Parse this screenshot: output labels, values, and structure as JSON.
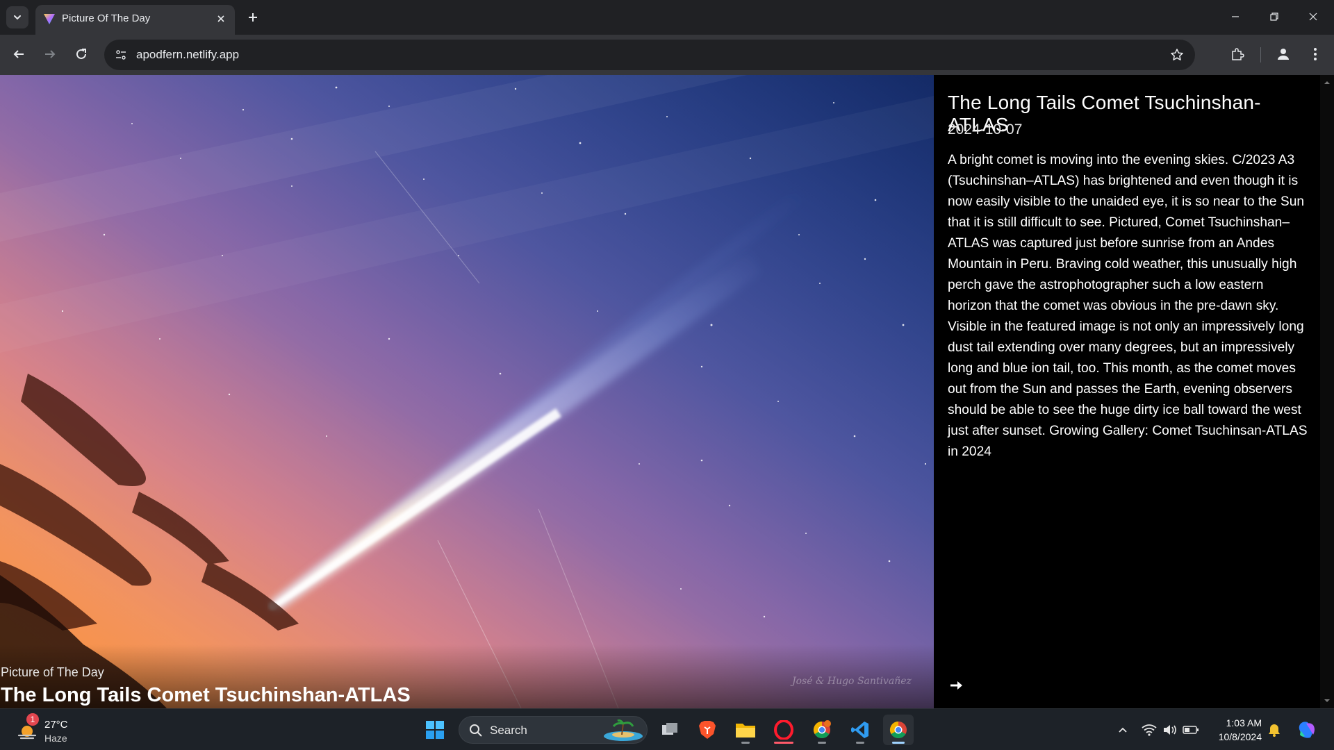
{
  "browser": {
    "tab_title": "Picture Of The Day",
    "url": "apodfern.netlify.app"
  },
  "page": {
    "kicker": "Picture of The Day",
    "headline": "The Long Tails Comet Tsuchinshan-ATLAS",
    "signature": "José & Hugo Santivañez",
    "info_title": "The Long Tails Comet Tsuchinshan-ATLAS",
    "date": "2024-10-07",
    "explanation": "A bright comet is moving into the evening skies. C/2023 A3 (Tsuchinshan–ATLAS) has brightened and even though it is now easily visible to the unaided eye, it is so near to the Sun that it is still difficult to see. Pictured, Comet Tsuchinshan–ATLAS was captured just before sunrise from an Andes Mountain in Peru. Braving cold weather, this unusually high perch gave the astrophotographer such a low eastern horizon that the comet was obvious in the pre-dawn sky. Visible in the featured image is not only an impressively long dust tail extending over many degrees, but an impressively long and blue ion tail, too.  This month, as the comet moves out from the Sun and passes the Earth, evening observers should be able to see the huge dirty ice ball toward the west just after sunset. Growing Gallery: Comet Tsuchinsan-ATLAS in 2024"
  },
  "taskbar": {
    "weather_badge": "1",
    "temperature": "27°C",
    "condition": "Haze",
    "search_label": "Search",
    "time": "1:03 AM",
    "date": "10/8/2024"
  },
  "colors": {
    "chrome_dark": "#202124",
    "chrome_toolbar": "#35363a",
    "taskbar": "#1d2228",
    "info_panel": "#000000"
  },
  "icons": {
    "tab_search": "chevron-down-icon",
    "favicon": "triangle-gradient-icon",
    "close": "close-icon",
    "new_tab": "plus-icon",
    "back": "arrow-left-icon",
    "forward": "arrow-right-icon",
    "reload": "reload-icon",
    "site_info": "tune-icon",
    "bookmark": "star-icon",
    "extensions": "puzzle-icon",
    "profile": "person-icon",
    "menu": "kebab-icon",
    "next": "arrow-right-icon"
  }
}
